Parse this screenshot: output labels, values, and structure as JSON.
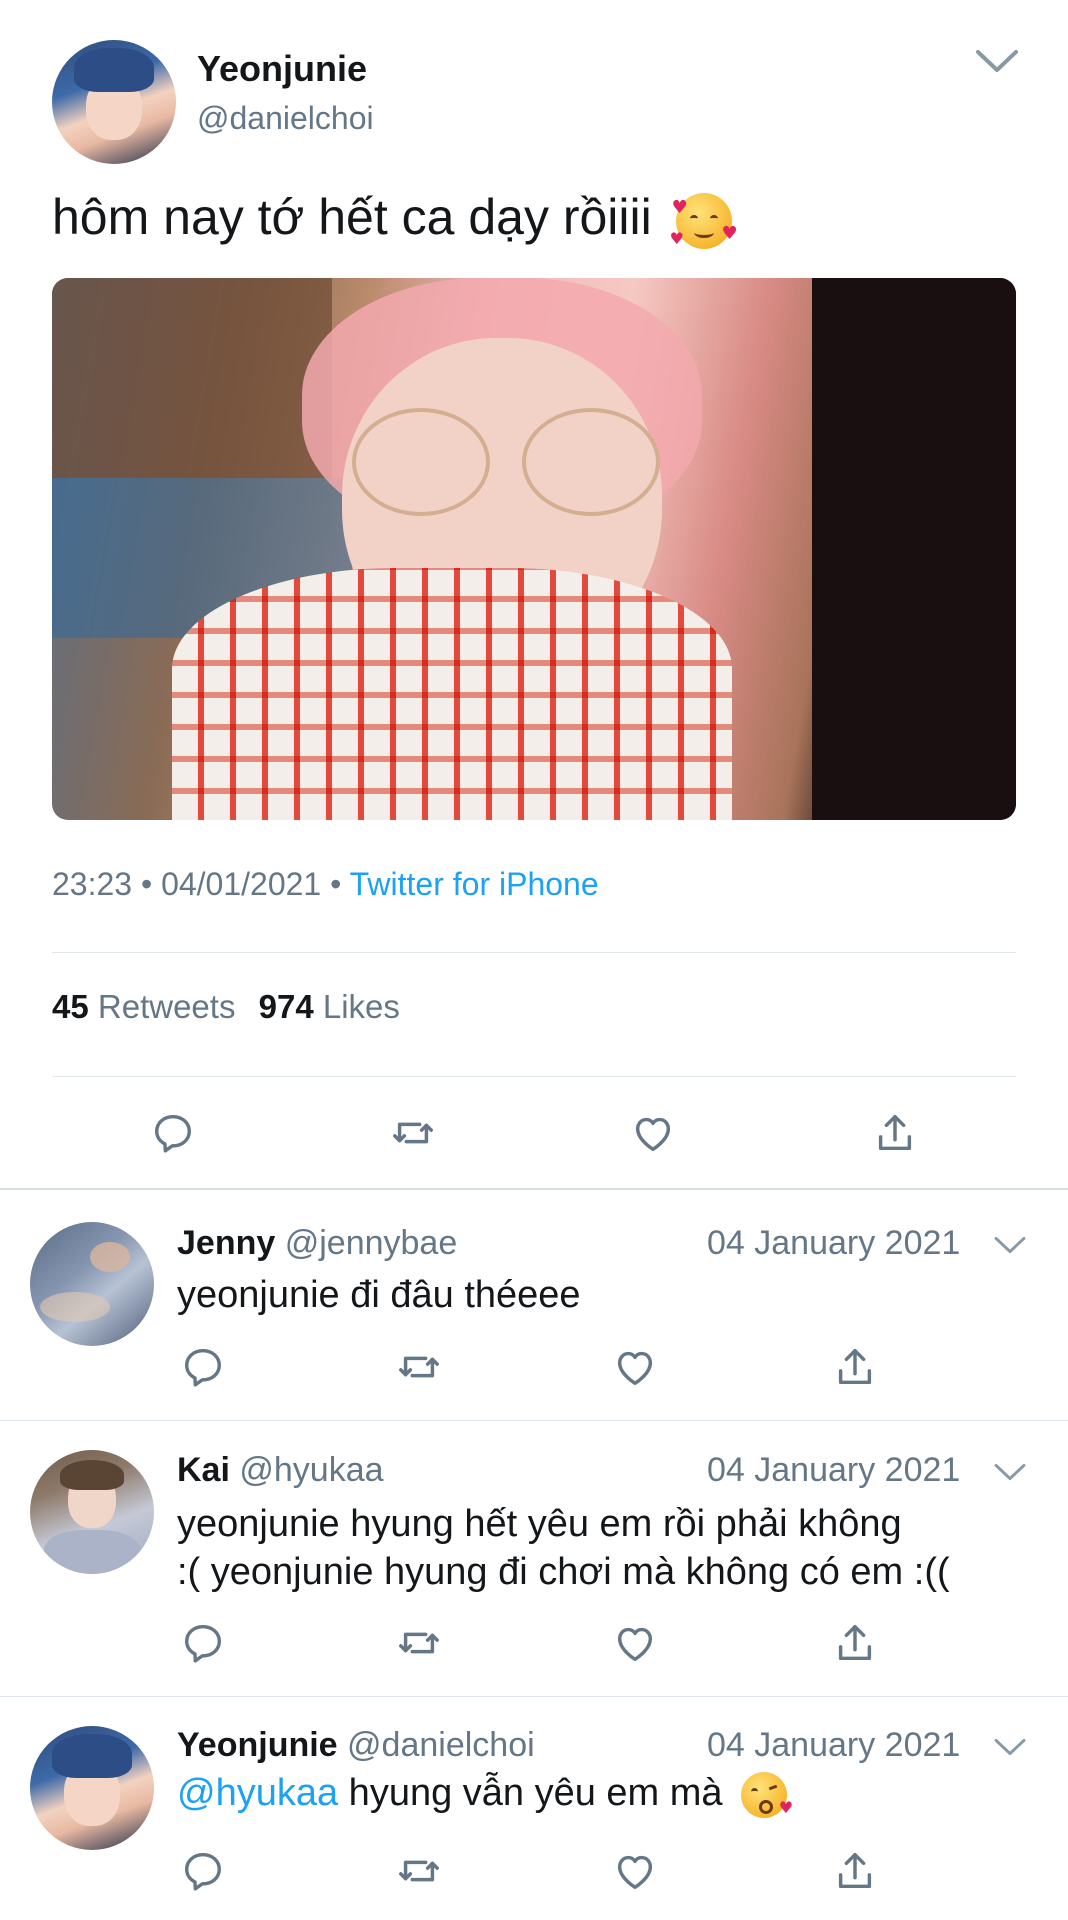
{
  "colors": {
    "accent": "#1da1f2",
    "muted": "#657786",
    "text": "#14171a",
    "divider": "#e1e8ed"
  },
  "main_tweet": {
    "display_name": "Yeonjunie",
    "handle": "@danielchoi",
    "text": "hôm nay tớ hết ca dạy rồiiii",
    "emoji": "smiling-face-with-hearts",
    "time": "23:23",
    "date": "04/01/2021",
    "sep": "•",
    "source": "Twitter for iPhone",
    "retweets_count": "45",
    "retweets_label": "Retweets",
    "likes_count": "974",
    "likes_label": "Likes"
  },
  "replies": [
    {
      "display_name": "Jenny",
      "handle": "@jennybae",
      "date": "04 January 2021",
      "text": "yeonjunie đi đâu théeee"
    },
    {
      "display_name": "Kai",
      "handle": "@hyukaa",
      "date": "04 January 2021",
      "text_line1": "yeonjunie hyung hết yêu em rồi phải không",
      "text_line2": ":( yeonjunie hyung đi chơi mà không có em :(("
    },
    {
      "display_name": "Yeonjunie",
      "handle": "@danielchoi",
      "date": "04 January 2021",
      "mention": "@hyukaa",
      "text": " hyung vẫn yêu em mà",
      "emoji": "face-blowing-a-kiss"
    }
  ]
}
